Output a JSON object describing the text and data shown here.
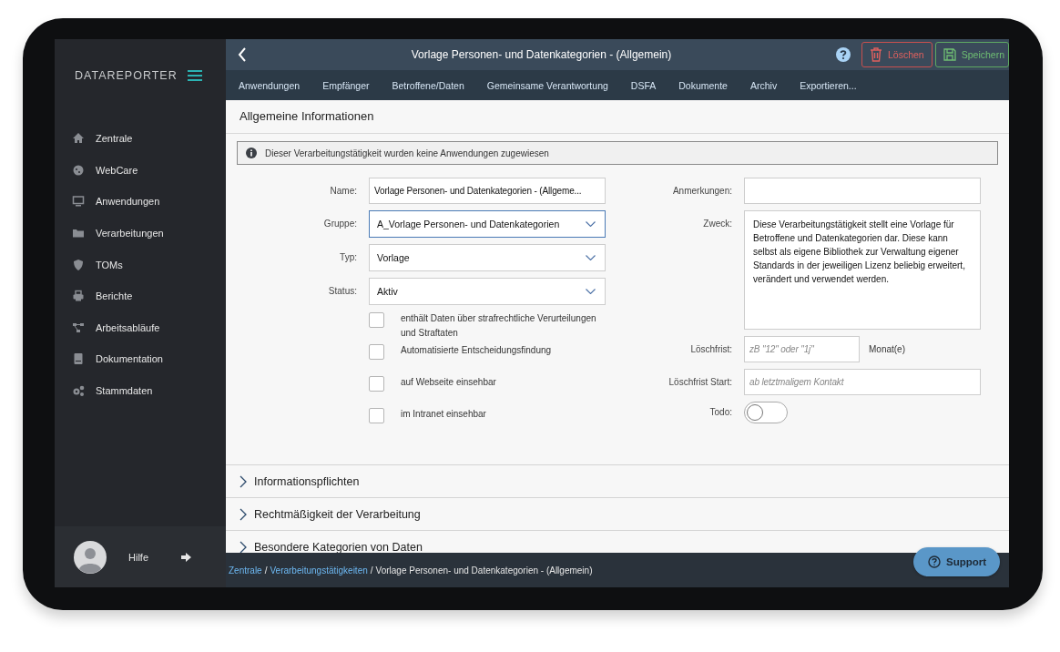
{
  "sidebar": {
    "logo": "DATAREPORTER",
    "items": [
      {
        "label": "Zentrale",
        "selected": false
      },
      {
        "label": "WebCare",
        "selected": false
      },
      {
        "label": "Anwendungen",
        "selected": false
      },
      {
        "label": "Verarbeitungen",
        "selected": false
      },
      {
        "label": "TOMs",
        "selected": false
      },
      {
        "label": "Berichte",
        "selected": false
      },
      {
        "label": "Arbeitsabläufe",
        "selected": false
      },
      {
        "label": "Dokumentation",
        "selected": false
      },
      {
        "label": "Stammdaten",
        "selected": false
      }
    ],
    "user": {
      "help": "Hilfe"
    }
  },
  "header": {
    "title": "Vorlage Personen- und Datenkategorien - (Allgemein)",
    "buttons": [
      {
        "label": "Löschen",
        "kind": "delete"
      },
      {
        "label": "Speichern",
        "kind": "save"
      }
    ]
  },
  "tabs": [
    {
      "label": "Anwendungen",
      "selected": false
    },
    {
      "label": "Empfänger",
      "selected": false
    },
    {
      "label": "Betroffene/Daten",
      "selected": false
    },
    {
      "label": "Gemeinsame Verantwortung",
      "selected": false
    },
    {
      "label": "DSFA",
      "selected": false
    },
    {
      "label": "Dokumente",
      "selected": false
    },
    {
      "label": "Archiv",
      "selected": false
    },
    {
      "label": "Exportieren...",
      "selected": false
    }
  ],
  "section": {
    "title": "Allgemeine Informationen",
    "info": "Dieser Verarbeitungstätigkeit wurden keine Anwendungen zugewiesen",
    "left_fields": [
      {
        "label": "Name:",
        "kind": "text",
        "value": "Vorlage Personen- und Datenkategorien - (Allgeme...",
        "focused": false
      },
      {
        "label": "Gruppe:",
        "kind": "select",
        "value": "A_Vorlage Personen- und Datenkategorien",
        "focused": true
      },
      {
        "label": "Typ:",
        "kind": "select",
        "value": "Vorlage",
        "focused": false
      },
      {
        "label": "Status:",
        "kind": "select",
        "value": "Aktiv",
        "focused": false
      }
    ],
    "checkboxes": [
      {
        "label": "enthält Daten über strafrechtliche Verurteilungen und Straftaten",
        "checked": false
      },
      {
        "label": "Automatisierte Entscheidungsfindung",
        "checked": false
      },
      {
        "label": "auf Webseite einsehbar",
        "checked": false
      },
      {
        "label": "im Intranet einsehbar",
        "checked": false
      }
    ],
    "right_fields": [
      {
        "label": "Anmerkungen:",
        "kind": "text",
        "focused": false
      },
      {
        "label": "Zweck:",
        "kind": "textarea",
        "value": "Diese Verarbeitungstätigkeit stellt eine Vorlage für Betroffene und Datenkategorien dar. Diese kann selbst als eigene Bibliothek zur Verwaltung eigener Standards in der jeweiligen Lizenz beliebig erweitert, verändert und verwendet werden.",
        "focused": false
      },
      {
        "label": "Löschfrist:",
        "kind": "short",
        "placeholder": "zB \"12\" oder \"1j\"",
        "unit": "Monat(e)",
        "focused": false
      },
      {
        "label": "Löschfrist Start:",
        "kind": "text",
        "placeholder": "ab letztmaligem Kontakt",
        "focused": false
      },
      {
        "label": "Todo:",
        "kind": "toggle",
        "on": false
      }
    ]
  },
  "accordions": [
    {
      "title": "Informationspflichten",
      "expanded": false
    },
    {
      "title": "Rechtmäßigkeit der Verarbeitung",
      "expanded": false
    },
    {
      "title": "Besondere Kategorien von Daten",
      "expanded": false
    }
  ],
  "breadcrumb": [
    {
      "label": "Zentrale",
      "kind": "link"
    },
    {
      "label": "/",
      "kind": "separator"
    },
    {
      "label": "Verarbeitungstätigkeiten",
      "kind": "link"
    },
    {
      "label": "/",
      "kind": "separator"
    },
    {
      "label": "Vorlage Personen- und Datenkategorien - (Allgemein)",
      "kind": "current"
    }
  ],
  "support": {
    "label": "Support"
  }
}
